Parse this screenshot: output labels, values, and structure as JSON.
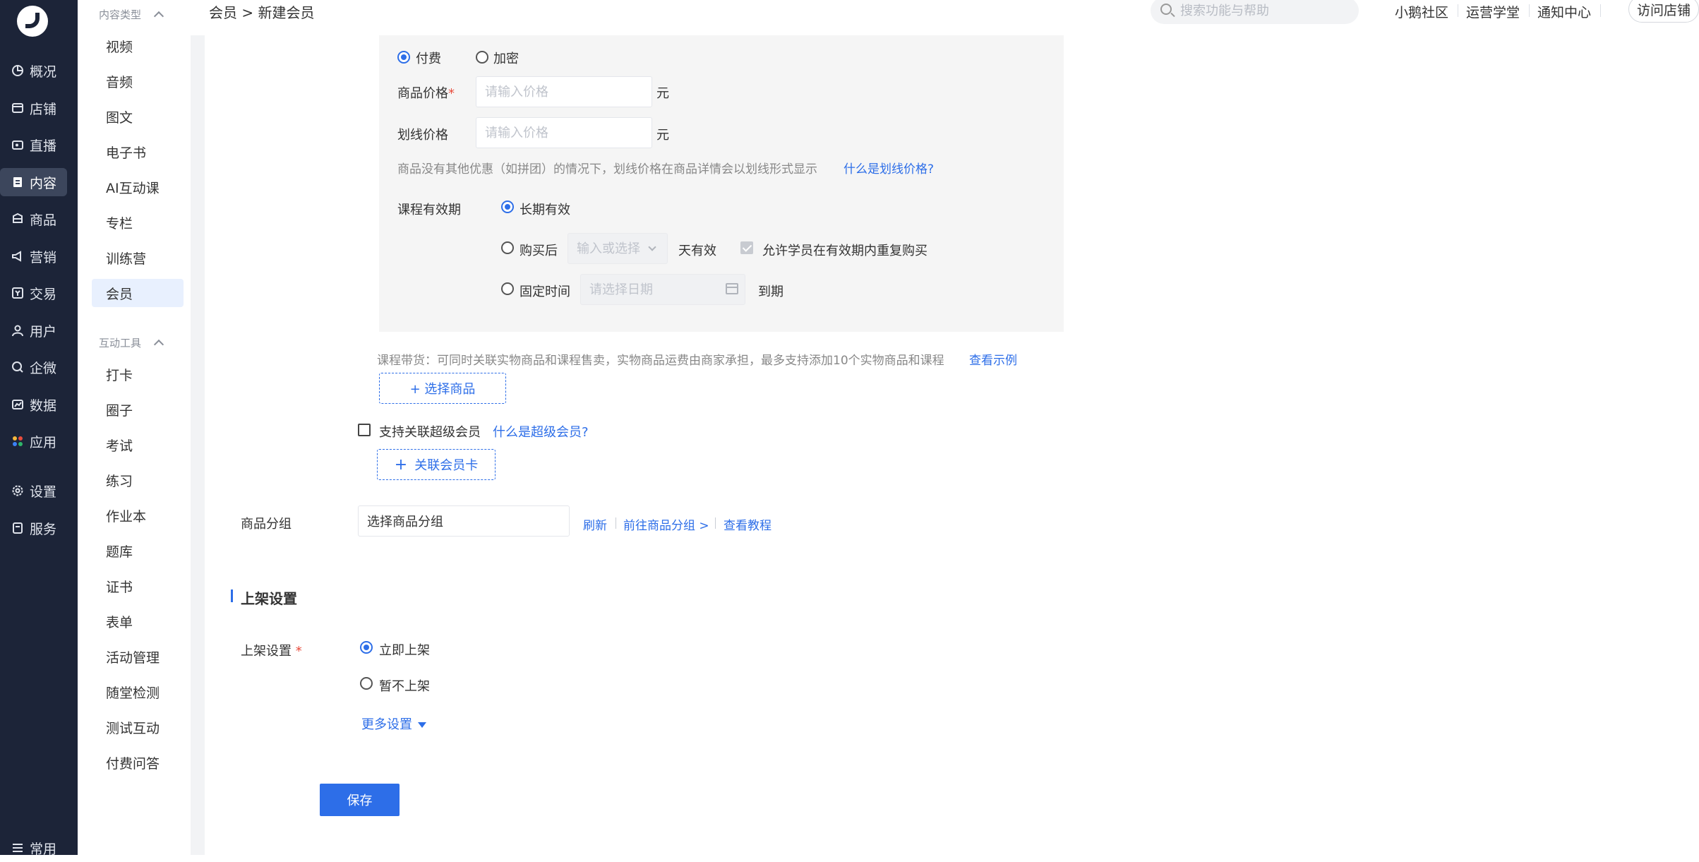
{
  "nav": {
    "items": [
      {
        "label": "概况",
        "icon": "pie-chart-icon"
      },
      {
        "label": "店铺",
        "icon": "store-icon"
      },
      {
        "label": "直播",
        "icon": "live-icon"
      },
      {
        "label": "内容",
        "icon": "content-icon"
      },
      {
        "label": "商品",
        "icon": "product-icon"
      },
      {
        "label": "营销",
        "icon": "megaphone-icon"
      },
      {
        "label": "交易",
        "icon": "trade-icon"
      },
      {
        "label": "用户",
        "icon": "user-icon"
      },
      {
        "label": "企微",
        "icon": "wecom-icon"
      },
      {
        "label": "数据",
        "icon": "data-icon"
      },
      {
        "label": "应用",
        "icon": "apps-icon"
      },
      {
        "label": "设置",
        "icon": "gear-icon"
      },
      {
        "label": "服务",
        "icon": "service-icon"
      },
      {
        "label": "常用",
        "icon": "list-icon"
      }
    ],
    "active": "内容"
  },
  "subnav": {
    "group1": "内容类型",
    "group1_items": [
      "视频",
      "音频",
      "图文",
      "电子书",
      "AI互动课",
      "专栏",
      "训练营",
      "会员"
    ],
    "group2": "互动工具",
    "group2_items": [
      "打卡",
      "圈子",
      "考试",
      "练习",
      "作业本",
      "题库",
      "证书",
      "表单",
      "活动管理",
      "随堂检测",
      "测试互动",
      "付费问答"
    ],
    "active": "会员"
  },
  "header": {
    "breadcrumb": "会员 > 新建会员",
    "search_placeholder": "搜索功能与帮助",
    "links": [
      "小鹅社区",
      "运营学堂",
      "通知中心"
    ],
    "visit_store": "访问店铺"
  },
  "pricing": {
    "type_paid": "付费",
    "type_encrypted": "加密",
    "price_label": "商品价格",
    "price_placeholder": "请输入价格",
    "unit": "元",
    "strike_label": "划线价格",
    "strike_placeholder": "请输入价格",
    "hint": "商品没有其他优惠（如拼团）的情况下，划线价格在商品详情会以划线形式显示",
    "hint_link": "什么是划线价格?",
    "validity_label": "课程有效期",
    "opt_forever": "长期有效",
    "opt_after_buy": "购买后",
    "days_placeholder": "输入或选择",
    "days_suffix": "天有效",
    "allow_rebuy": "允许学员在有效期内重复购买",
    "opt_fixed": "固定时间",
    "date_placeholder": "请选择日期",
    "expire_suffix": "到期"
  },
  "goods": {
    "hint": "课程带货：可同时关联实物商品和课程售卖，实物商品运费由商家承担，最多支持添加10个实物商品和课程",
    "example_link": "查看示例",
    "select_button": "+ 选择商品"
  },
  "super_member": {
    "checkbox_label": "支持关联超级会员",
    "link": "什么是超级会员?",
    "button": "关联会员卡"
  },
  "group": {
    "label": "商品分组",
    "select_value": "选择商品分组",
    "refresh": "刷新",
    "goto": "前往商品分组 >",
    "tutorial": "查看教程"
  },
  "listing": {
    "section_title": "上架设置",
    "label": "上架设置",
    "opt_now": "立即上架",
    "opt_later": "暂不上架",
    "more": "更多设置",
    "save": "保存"
  }
}
